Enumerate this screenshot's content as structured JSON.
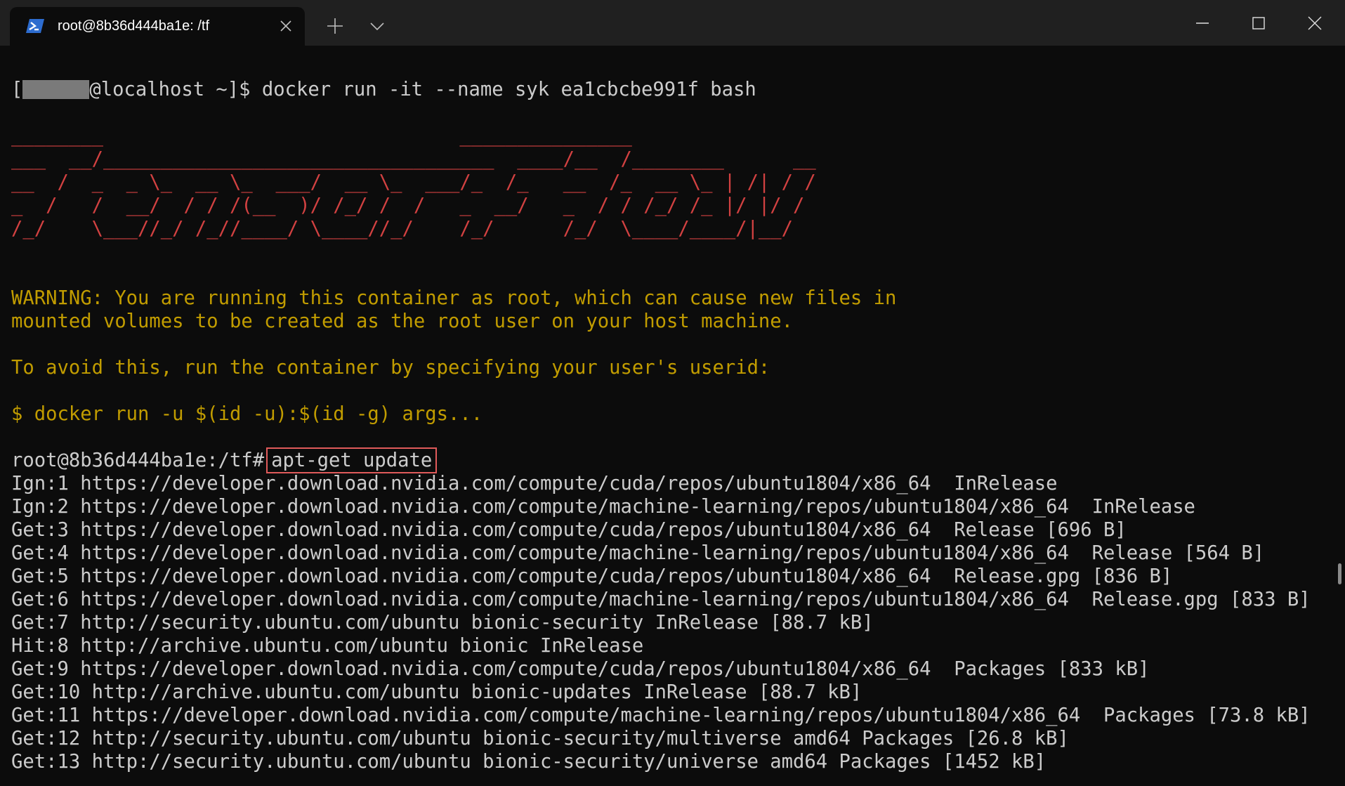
{
  "tab": {
    "title": "root@8b36d444ba1e: /tf"
  },
  "terminal": {
    "prompt_user_suffix": "@localhost ~]$ docker run -it --name syk ea1cbcbe991f bash",
    "banner": [
      "________                               _______________",
      "___  __/__________________________________  ____/__  /________      __",
      "__  /  _  _ \\_  __ \\_  ___/  __ \\_  ___/_  /_   __  /_  __ \\_ | /| / /",
      "_  /   /  __/  / / /(__  )/ /_/ /  /   _  __/   _  / / /_/ /_ |/ |/ /",
      "/_/    \\___//_/ /_//____/ \\____//_/    /_/      /_/  \\____/____/|__/"
    ],
    "warning": [
      "WARNING: You are running this container as root, which can cause new files in",
      "mounted volumes to be created as the root user on your host machine."
    ],
    "avoid": "To avoid this, run the container by specifying your user's userid:",
    "docker_hint": "$ docker run -u $(id -u):$(id -g) args...",
    "root_prompt": "root@8b36d444ba1e:/tf#",
    "command": "apt-get update",
    "output": [
      "Ign:1 https://developer.download.nvidia.com/compute/cuda/repos/ubuntu1804/x86_64  InRelease",
      "Ign:2 https://developer.download.nvidia.com/compute/machine-learning/repos/ubuntu1804/x86_64  InRelease",
      "Get:3 https://developer.download.nvidia.com/compute/cuda/repos/ubuntu1804/x86_64  Release [696 B]",
      "Get:4 https://developer.download.nvidia.com/compute/machine-learning/repos/ubuntu1804/x86_64  Release [564 B]",
      "Get:5 https://developer.download.nvidia.com/compute/cuda/repos/ubuntu1804/x86_64  Release.gpg [836 B]",
      "Get:6 https://developer.download.nvidia.com/compute/machine-learning/repos/ubuntu1804/x86_64  Release.gpg [833 B]",
      "Get:7 http://security.ubuntu.com/ubuntu bionic-security InRelease [88.7 kB]",
      "Hit:8 http://archive.ubuntu.com/ubuntu bionic InRelease",
      "Get:9 https://developer.download.nvidia.com/compute/cuda/repos/ubuntu1804/x86_64  Packages [833 kB]",
      "Get:10 http://archive.ubuntu.com/ubuntu bionic-updates InRelease [88.7 kB]",
      "Get:11 https://developer.download.nvidia.com/compute/machine-learning/repos/ubuntu1804/x86_64  Packages [73.8 kB]",
      "Get:12 http://security.ubuntu.com/ubuntu bionic-security/multiverse amd64 Packages [26.8 kB]",
      "Get:13 http://security.ubuntu.com/ubuntu bionic-security/universe amd64 Packages [1452 kB]"
    ]
  },
  "colors": {
    "banner": "#d24141",
    "warning": "#c19c00",
    "text": "#cccccc",
    "highlight_box": "#e05a5a"
  }
}
